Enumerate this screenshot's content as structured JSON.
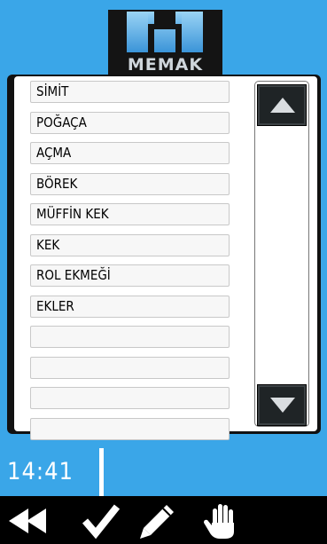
{
  "header": {
    "logo_text": "MEMAK"
  },
  "list": {
    "items": [
      {
        "label": "SİMİT"
      },
      {
        "label": "POĞAÇA"
      },
      {
        "label": "AÇMA"
      },
      {
        "label": "BÖREK"
      },
      {
        "label": "MÜFFİN KEK"
      },
      {
        "label": "KEK"
      },
      {
        "label": "ROL EKMEĞİ"
      },
      {
        "label": "EKLER"
      },
      {
        "label": ""
      },
      {
        "label": ""
      },
      {
        "label": ""
      },
      {
        "label": ""
      }
    ]
  },
  "scroll": {
    "up_icon": "triangle-up-icon",
    "down_icon": "triangle-down-icon"
  },
  "status": {
    "time": "14:41"
  },
  "toolbar": {
    "icons": [
      "rewind-icon",
      "check-icon",
      "pencil-icon",
      "hand-icon"
    ]
  },
  "colors": {
    "accent": "#3aa6e8",
    "frame": "#111111",
    "toolbar": "#000000"
  }
}
